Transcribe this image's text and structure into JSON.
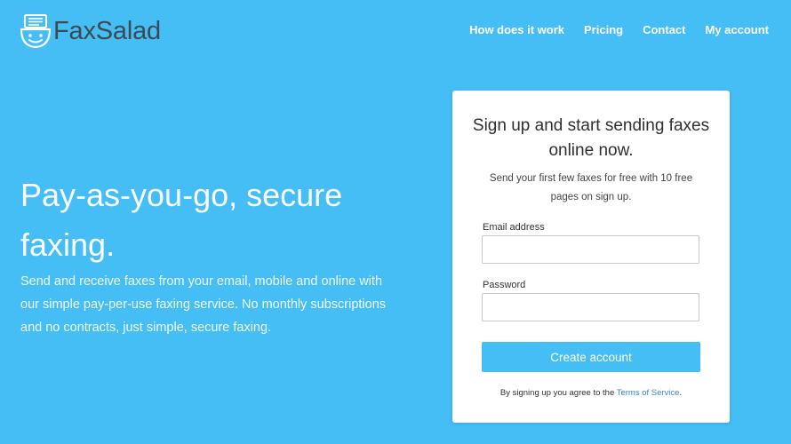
{
  "brand": {
    "name_part1": "Fax",
    "name_part2": "Salad",
    "icon": "faxsalad-logo-icon"
  },
  "nav": {
    "items": [
      {
        "label": "How does it work"
      },
      {
        "label": "Pricing"
      },
      {
        "label": "Contact"
      },
      {
        "label": "My account"
      }
    ]
  },
  "hero": {
    "title": "Pay-as-you-go, secure faxing.",
    "description": "Send and receive faxes from your email, mobile and online with our simple pay-per-use faxing service. No monthly subscriptions and no contracts, just simple, secure faxing."
  },
  "signup": {
    "title": "Sign up and start sending faxes online now.",
    "subtitle": "Send your first few faxes for free with 10 free pages on sign up.",
    "email_label": "Email address",
    "email_value": "",
    "password_label": "Password",
    "password_value": "",
    "button_label": "Create account",
    "terms_prefix": "By signing up you agree to the",
    "terms_link": "Terms of Service",
    "terms_suffix": "."
  },
  "colors": {
    "background": "#45bdf5",
    "card": "#ffffff",
    "button": "#45bdf5",
    "link": "#3a87c8"
  }
}
